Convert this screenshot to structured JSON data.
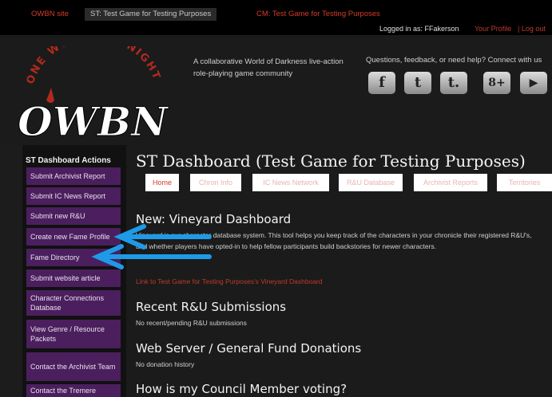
{
  "topnav": {
    "tabs": [
      "OWBN site",
      "ST: Test Game for Testing Purposes",
      "CM: Test Game for Testing Purposes"
    ]
  },
  "login": {
    "logged_in_as": "Logged in as: FFakerson",
    "profile": "Your Profile",
    "logout": "| Log out"
  },
  "header": {
    "logo_text": "ONE WORLD BY NIGHT",
    "logo_mark": "OWBN",
    "tagline": "A collaborative World of Darkness live-action role-playing game community",
    "contact": "Questions, feedback, or need help? Connect with us",
    "social": [
      "f",
      "t",
      "t.",
      "8+",
      "▶"
    ]
  },
  "sidebar": {
    "title": "ST Dashboard Actions",
    "items": [
      "Submit Archivist Report",
      "Submit IC News Report",
      "Submit new R&U",
      "Create new Fame Profile",
      "Fame Directory",
      "Submit website article",
      "Character Connections Database",
      "View Genre / Resource Packets",
      "Contact the Archivist Team",
      "Contact the Tremere"
    ]
  },
  "main": {
    "title": "ST Dashboard (Test Game for Testing Purposes)",
    "tabs": [
      "Home",
      "Chron Info",
      "IC News Network",
      "R&U Database",
      "Archivist Reports",
      "Territories"
    ],
    "vineyard_heading": "New: Vineyard Dashboard",
    "vineyard_text": "Vineyard is our character database system. This tool helps you keep track of the characters in your chronicle their registered R&U's, and whether players have opted-in to help fellow participants build backstories for newer characters.",
    "vineyard_link": "Link to Test Game for Testing Purposes's Vineyard Dashboard",
    "ru_heading": "Recent R&U Submissions",
    "ru_text": "No recent/pending R&U submissions",
    "donations_heading": "Web Server / General Fund Donations",
    "donations_text": "No donation history",
    "council_heading": "How is my Council Member voting?"
  },
  "colors": {
    "accent_red": "#d63b2a",
    "sidebar_purple": "#4b1f5e",
    "arrow_blue": "#1e9be8"
  }
}
